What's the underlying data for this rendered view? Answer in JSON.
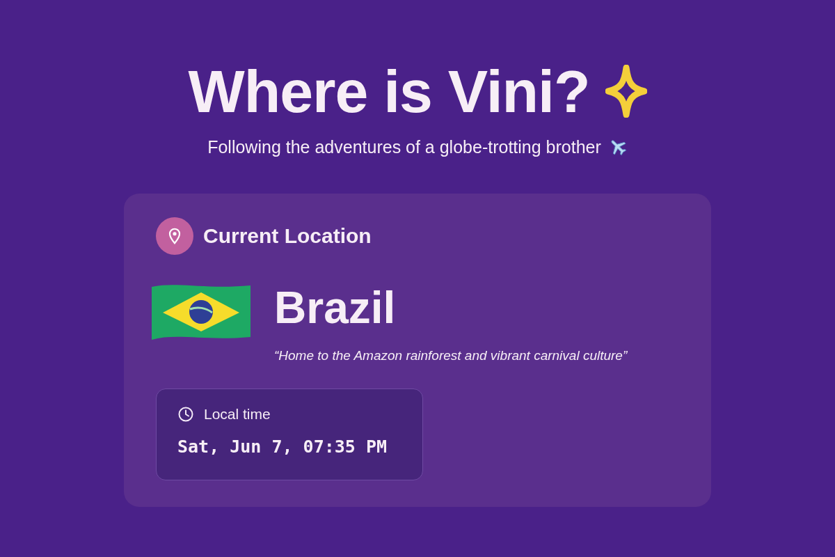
{
  "header": {
    "title": "Where is Vini?",
    "subtitle": "Following the adventures of a globe-trotting brother"
  },
  "card": {
    "heading": "Current Location",
    "country": "Brazil",
    "description": "“Home to the Amazon rainforest and vibrant carnival culture”",
    "local_time": {
      "label": "Local time",
      "value": "Sat, Jun 7, 07:35 PM"
    }
  }
}
